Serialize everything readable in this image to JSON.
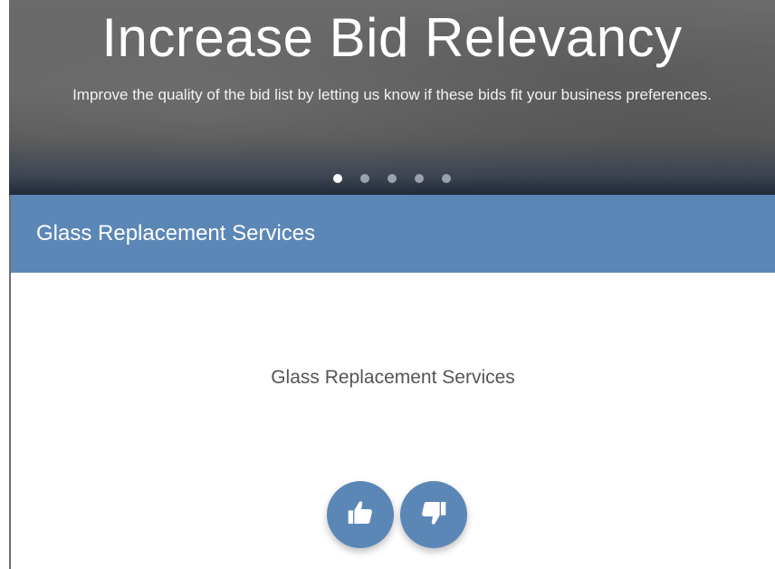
{
  "hero": {
    "title": "Increase Bid Relevancy",
    "subtitle": "Improve the quality of the bid list by letting us know if these bids fit your business preferences.",
    "slides": [
      {
        "active": true
      },
      {
        "active": false
      },
      {
        "active": false
      },
      {
        "active": false
      },
      {
        "active": false
      }
    ]
  },
  "card": {
    "header_title": "Glass Replacement Services",
    "body_text": "Glass Replacement Services"
  },
  "actions": {
    "like_icon": "thumbs-up-icon",
    "dislike_icon": "thumbs-down-icon"
  },
  "colors": {
    "accent": "#5b87b7",
    "header_text": "#ffffff",
    "body_text": "#555555"
  }
}
